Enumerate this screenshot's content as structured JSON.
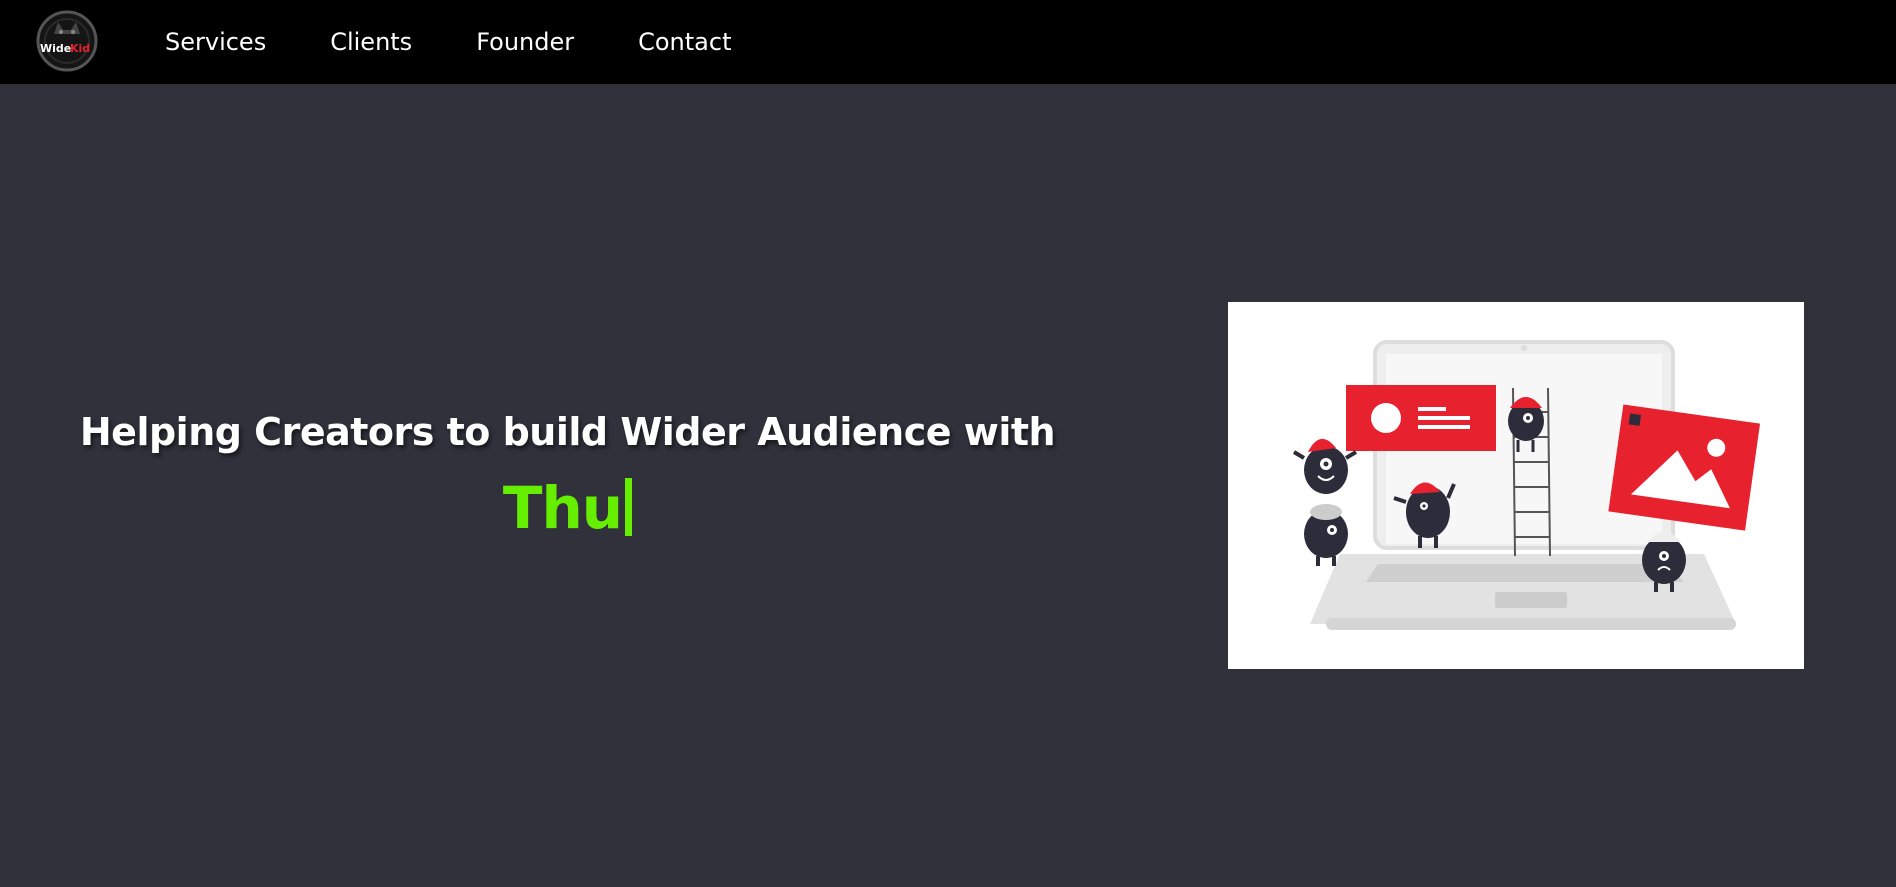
{
  "brand": {
    "logo_text_white": "Wide",
    "logo_text_red": "Kid",
    "logo_icon": "wolf-emblem-icon"
  },
  "nav": {
    "items": [
      {
        "label": "Services"
      },
      {
        "label": "Clients"
      },
      {
        "label": "Founder"
      },
      {
        "label": "Contact"
      }
    ]
  },
  "hero": {
    "headline": "Helping Creators to build Wider Audience with",
    "typed_text": "Thu"
  },
  "illustration": {
    "icon": "creators-building-laptop-illustration"
  },
  "colors": {
    "background": "#31313c",
    "navbar": "#000000",
    "accent_green": "#66ee00",
    "accent_red": "#e8212e"
  }
}
